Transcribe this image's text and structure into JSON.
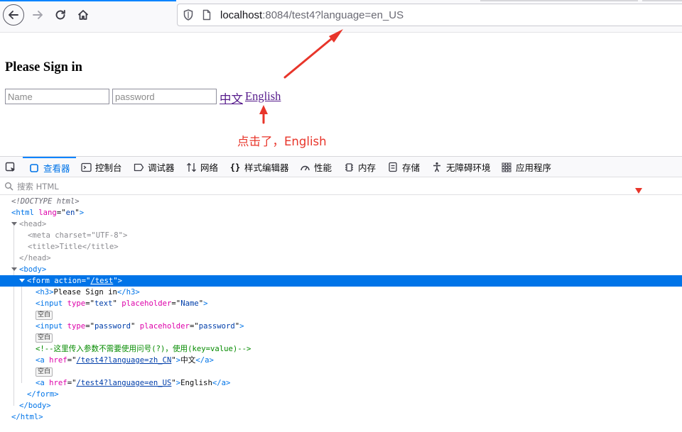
{
  "browser": {
    "url": {
      "host": "localhost",
      "port_path": ":8084/test4?language=en_US"
    }
  },
  "page": {
    "heading": "Please Sign in",
    "name_placeholder": "Name",
    "password_placeholder": "password",
    "link_zh": "中文",
    "link_en": "English",
    "annotation": "点击了，English"
  },
  "devtools": {
    "tabs": [
      {
        "label": "查看器",
        "icon": "inspector-icon",
        "active": true
      },
      {
        "label": "控制台",
        "icon": "console-icon"
      },
      {
        "label": "调试器",
        "icon": "debugger-icon"
      },
      {
        "label": "网络",
        "icon": "network-icon"
      },
      {
        "label": "样式编辑器",
        "icon": "style-editor-icon"
      },
      {
        "label": "性能",
        "icon": "performance-icon"
      },
      {
        "label": "内存",
        "icon": "memory-icon"
      },
      {
        "label": "存储",
        "icon": "storage-icon"
      },
      {
        "label": "无障碍环境",
        "icon": "accessibility-icon"
      },
      {
        "label": "应用程序",
        "icon": "application-icon"
      }
    ],
    "search_placeholder": "搜索 HTML",
    "markup": {
      "doctype": "<!DOCTYPE html>",
      "html_open": {
        "tag": "html",
        "attr": "lang",
        "value": "en"
      },
      "head": "head",
      "meta": {
        "tag": "meta",
        "attr": "charset",
        "value": "UTF-8"
      },
      "title": {
        "tag": "title",
        "text": "Title"
      },
      "body": "body",
      "form": {
        "tag": "form",
        "attr": "action",
        "value": "/test"
      },
      "h3": {
        "tag": "h3",
        "text": "Please Sign in"
      },
      "input1": {
        "tag": "input",
        "attr1": "type",
        "val1": "text",
        "attr2": "placeholder",
        "val2": "Name"
      },
      "whitespace_badge": "空白",
      "input2": {
        "tag": "input",
        "attr1": "type",
        "val1": "password",
        "attr2": "placeholder",
        "val2": "password"
      },
      "comment": "<!--这里传入参数不需要使用问号(?)，使用(key=value)-->",
      "a1": {
        "tag": "a",
        "attr": "href",
        "value": "/test4?language=zh_CN",
        "text": "中文"
      },
      "a2": {
        "tag": "a",
        "attr": "href",
        "value": "/test4?language=en_US",
        "text": "English"
      }
    }
  },
  "colors": {
    "accent": "#0074e8",
    "annotation": "#e8352a",
    "link_visited": "#551a8b"
  }
}
